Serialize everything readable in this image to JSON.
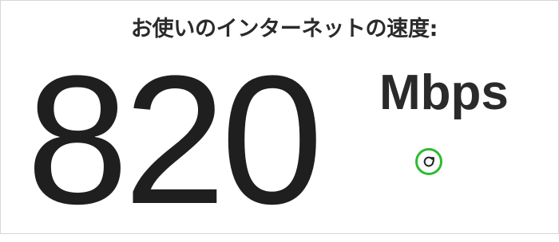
{
  "header": {
    "title": "お使いのインターネットの速度:"
  },
  "speed": {
    "value": "820",
    "unit": "Mbps"
  },
  "controls": {
    "refresh_icon": "refresh-icon",
    "accent_color": "#2dbb2d"
  }
}
